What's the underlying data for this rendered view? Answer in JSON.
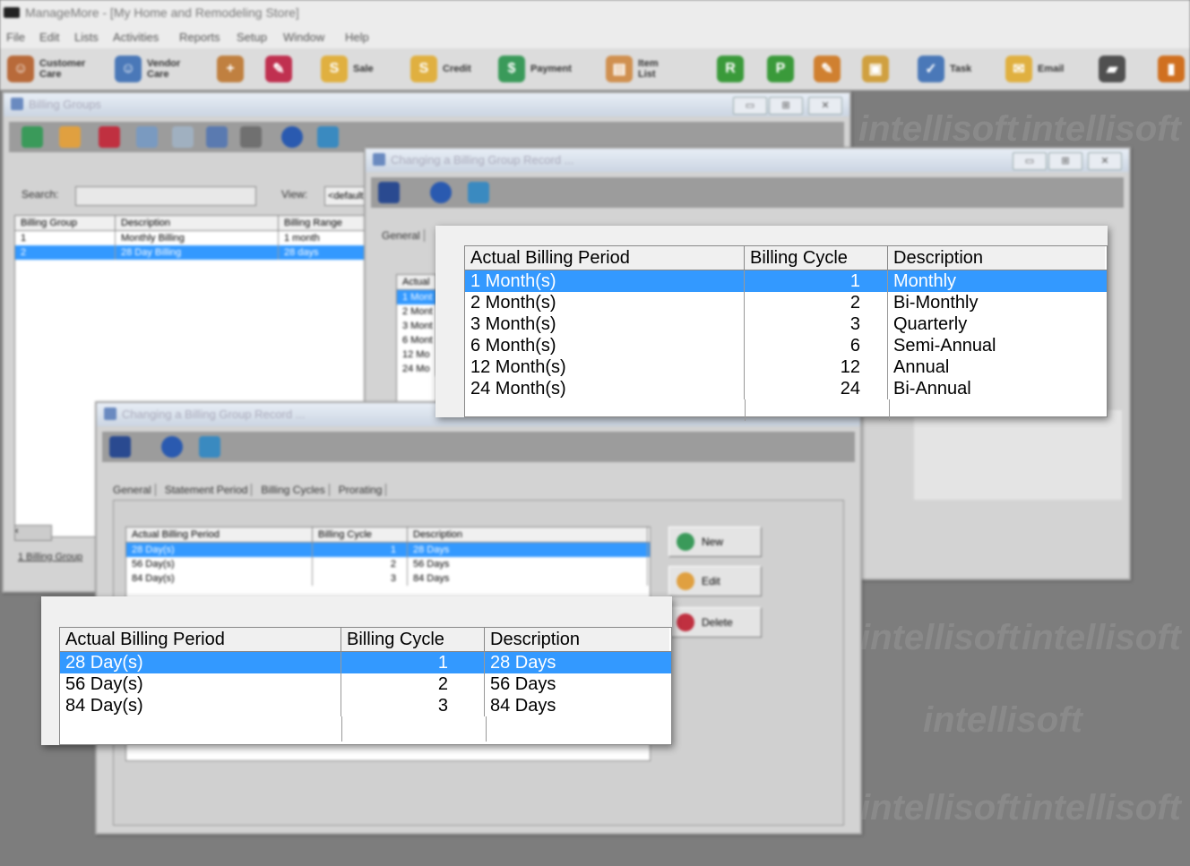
{
  "app": {
    "title": "ManageMore - [My Home and Remodeling Store]",
    "menu": [
      "File",
      "Edit",
      "Lists",
      "Activities",
      "Reports",
      "Setup",
      "Window",
      "Help"
    ]
  },
  "toolbar": {
    "customer_care": "Customer Care",
    "vendor_care": "Vendor Care",
    "sale": "Sale",
    "credit": "Credit",
    "payment": "Payment",
    "item_list": "Item List",
    "task": "Task",
    "email": "Email"
  },
  "watermark": "intellisoft",
  "billing_groups": {
    "title": "Billing Groups",
    "search_label": "Search:",
    "view_label": "View:",
    "view_value": "<default>",
    "columns": [
      "Billing Group",
      "Description",
      "Billing Range"
    ],
    "rows": [
      {
        "group": "1",
        "description": "Monthly Billing",
        "range": "1 month"
      },
      {
        "group": "2",
        "description": "28 Day Billing",
        "range": "28 days"
      }
    ],
    "status": "1 Billing Group"
  },
  "change_record_back": {
    "title": "Changing a Billing Group Record ...",
    "tab_general": "General",
    "partial_header": "Actual",
    "partial_rows": [
      "1 Mont",
      "2 Mont",
      "3 Mont",
      "6 Mont",
      "12 Mo",
      "24 Mo"
    ]
  },
  "change_record_front": {
    "title": "Changing a Billing Group Record ...",
    "tabs": [
      "General",
      "Statement Period",
      "Billing Cycles",
      "Prorating"
    ],
    "buttons": {
      "new": "New",
      "edit": "Edit",
      "delete": "Delete"
    }
  },
  "monthly_cycles": {
    "columns": [
      "Actual Billing Period",
      "Billing Cycle",
      "Description"
    ],
    "rows": [
      {
        "period": "1 Month(s)",
        "cycle": "1",
        "description": "Monthly"
      },
      {
        "period": "2 Month(s)",
        "cycle": "2",
        "description": "Bi-Monthly"
      },
      {
        "period": "3 Month(s)",
        "cycle": "3",
        "description": "Quarterly"
      },
      {
        "period": "6 Month(s)",
        "cycle": "6",
        "description": "Semi-Annual"
      },
      {
        "period": "12 Month(s)",
        "cycle": "12",
        "description": "Annual"
      },
      {
        "period": "24 Month(s)",
        "cycle": "24",
        "description": "Bi-Annual"
      }
    ]
  },
  "day_cycles": {
    "columns": [
      "Actual Billing Period",
      "Billing Cycle",
      "Description"
    ],
    "rows": [
      {
        "period": "28 Day(s)",
        "cycle": "1",
        "description": "28 Days"
      },
      {
        "period": "56 Day(s)",
        "cycle": "2",
        "description": "56 Days"
      },
      {
        "period": "84 Day(s)",
        "cycle": "3",
        "description": "84 Days"
      }
    ]
  },
  "colors": {
    "selection": "#3399ff",
    "desktop": "#7d7d7d",
    "window": "#d3d3d3"
  }
}
